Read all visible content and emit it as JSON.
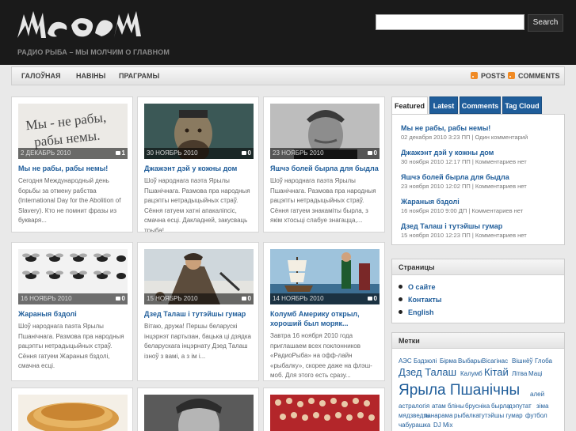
{
  "header": {
    "logo_alt": "Радио Рыба logo",
    "tagline": "РАДИО РЫБА – МЫ МОЛЧИМ О ГЛАВНОМ",
    "search_placeholder": "",
    "search_button": "Search"
  },
  "nav": {
    "items": [
      {
        "label": "ГАЛОЎНАЯ"
      },
      {
        "label": "НАВІНЫ"
      },
      {
        "label": "ПРАГРАМЫ"
      }
    ],
    "posts_label": "POSTS",
    "comments_label": "COMMENTS",
    "rss_icon": "rss-icon"
  },
  "posts": [
    {
      "date": "2 ДЕКАБРЬ 2010",
      "comments": "1",
      "title": "Мы не рабы, рабы немы!",
      "excerpt": "Сегодня Международный день борьбы за отмену рабства (International Day for the Abolition of Slavery). Кто не помнит фразы из букваря..."
    },
    {
      "date": "30 НОЯБРЬ 2010",
      "comments": "0",
      "title": "Джажэнт дэй у кожны дом",
      "excerpt": "Шоў народнага паэта Ярылы Пшанічнага. Размова пра народныя рацэпты нетрадыцыйных страў. Сёння гатуем хатні апакаліпсіс, смачна есці. Дакладней, закусваць трыба!"
    },
    {
      "date": "23 НОЯБРЬ 2010",
      "comments": "0",
      "title": "Яшчэ болей бырла для быдла",
      "excerpt": "Шоў народнага паэта Ярылы Пшанічнага. Размова пра народныя рацэпты нетрадыцыйных страў. Сёння гатуем знакаміты бырла, з якім хтосьці слабуе знагацца,..."
    },
    {
      "date": "16 НОЯБРЬ 2010",
      "comments": "0",
      "title": "Жараныя бздолі",
      "excerpt": "Шоў народнага паэта Ярылы Пшанічнага. Размова пра народныя рацэпты нетрадыцыйных страў. Сёння гатуем Жараныя бздолі, смачна есці."
    },
    {
      "date": "15 НОЯБРЬ 2010",
      "comments": "0",
      "title": "Дзед Талаш і тутэйшы гумар",
      "excerpt": "Вітаю, дружа! Першы беларускі інцэрнэт партызан, бацька ці дзядка беларускага інцэрнату Дзед Талаш ізноў з вамі, а з ім і..."
    },
    {
      "date": "14 НОЯБРЬ 2010",
      "comments": "0",
      "title": "Колумб Америку открыл, хороший был моряк...",
      "excerpt": "Завтра 16 ноября 2010 года приглашаем всех поклонников «РадиоРыба» на офф-лайн «рыбалку», скорее даже на флэш-моб. Для этого есть сразу..."
    },
    {
      "date": "",
      "comments": "",
      "title": "",
      "excerpt": ""
    },
    {
      "date": "",
      "comments": "",
      "title": "",
      "excerpt": ""
    },
    {
      "date": "",
      "comments": "",
      "title": "",
      "excerpt": ""
    }
  ],
  "sidebar": {
    "tabs": [
      {
        "label": "Featured"
      },
      {
        "label": "Latest"
      },
      {
        "label": "Comments"
      },
      {
        "label": "Tag Cloud"
      }
    ],
    "featured": [
      {
        "title": "Мы не рабы, рабы немы!",
        "meta": "02 декабря 2010 3:23 ПП | Один комментарий"
      },
      {
        "title": "Джажэнт дэй у кожны дом",
        "meta": "30 ноября 2010 12:17 ПП | Комментариев нет"
      },
      {
        "title": "Яшчэ болей бырла для быдла",
        "meta": "23 ноября 2010 12:02 ПП | Комментариев нет"
      },
      {
        "title": "Жараныя бздолі",
        "meta": "16 ноября 2010 9:00 ДП | Комментариев нет"
      },
      {
        "title": "Дзед Талаш і тутэйшы гумар",
        "meta": "15 ноября 2010 12:23 ПП | Комментариев нет"
      }
    ],
    "pages_heading": "Страницы",
    "pages": [
      {
        "label": "О сайте"
      },
      {
        "label": "Контакты"
      },
      {
        "label": "English"
      }
    ],
    "tags_heading": "Метки",
    "tags": [
      {
        "label": "АЭС"
      },
      {
        "label": "Бздзюлі"
      },
      {
        "label": "Бірма"
      },
      {
        "label": "Выбары"
      },
      {
        "label": "Вісагінас"
      },
      {
        "label": "Вішнёў"
      },
      {
        "label": "Глоба"
      },
      {
        "label": "Дзед Талаш"
      },
      {
        "label": "Калумб"
      },
      {
        "label": "Кітай"
      },
      {
        "label": "Літва"
      },
      {
        "label": "Мацi"
      },
      {
        "label": "Ярыла Пшанічны"
      },
      {
        "label": "алей"
      },
      {
        "label": "астралогія"
      },
      {
        "label": "атам"
      },
      {
        "label": "бліны"
      },
      {
        "label": "брусніка"
      },
      {
        "label": "бырла"
      },
      {
        "label": "дэпутат"
      },
      {
        "label": "зіма"
      },
      {
        "label": "мядзведзь"
      },
      {
        "label": "панарама"
      },
      {
        "label": "рыбалка"
      },
      {
        "label": "тутэйшы гумар"
      },
      {
        "label": "футбол"
      },
      {
        "label": "чабурашка"
      },
      {
        "label": "DJ Mix"
      }
    ]
  }
}
